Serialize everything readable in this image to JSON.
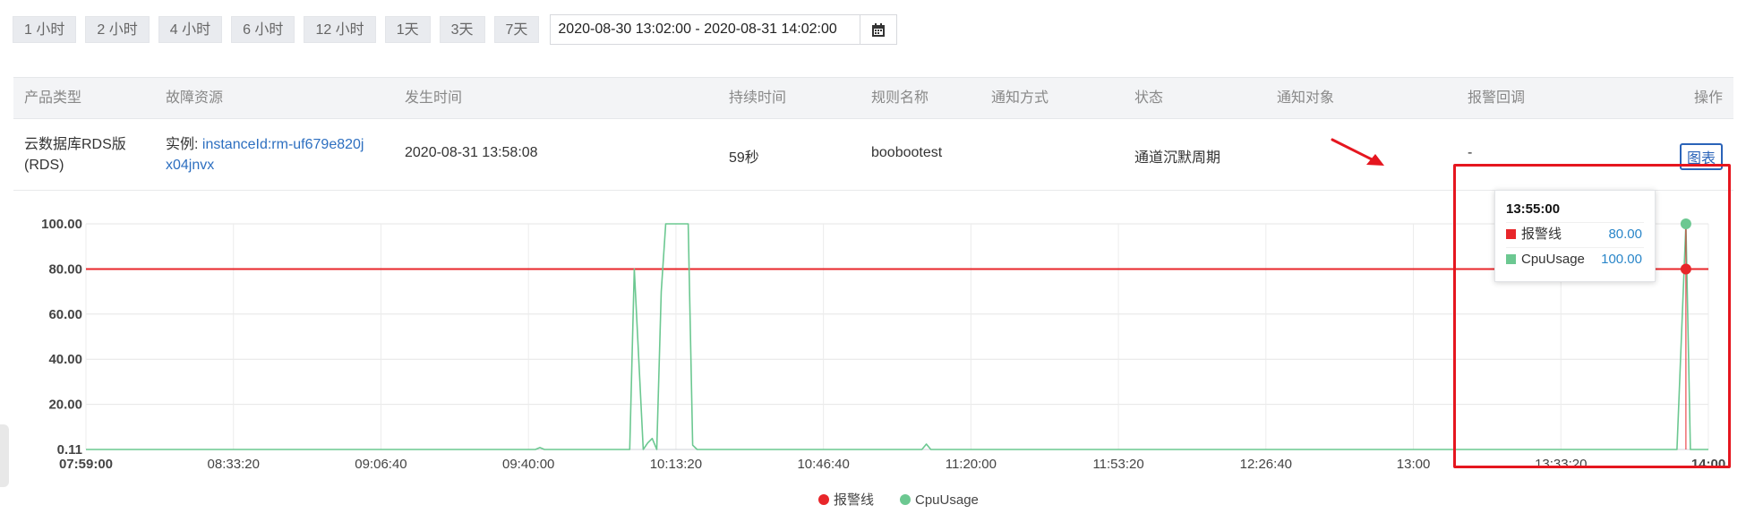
{
  "time_ranges": [
    "1 小时",
    "2 小时",
    "4 小时",
    "6 小时",
    "12 小时",
    "1天",
    "3天",
    "7天"
  ],
  "date_range": {
    "value": "2020-08-30 13:02:00 - 2020-08-31 14:02:00"
  },
  "calendar_icon": "calendar-icon",
  "table": {
    "headers": {
      "product_type": "产品类型",
      "fault_resource": "故障资源",
      "occurred_time": "发生时间",
      "duration": "持续时间",
      "rule_name": "规则名称",
      "notify_method": "通知方式",
      "status": "状态",
      "notify_target": "通知对象",
      "alarm_callback": "报警回调",
      "actions": "操作"
    },
    "row": {
      "product_type_line1": "云数据库RDS版",
      "product_type_line2": "(RDS)",
      "resource_prefix": "实例: ",
      "resource_link_line1": "instanceId:rm-uf679e820j",
      "resource_link_line2": "x04jnvx",
      "occurred_time": "2020-08-31 13:58:08",
      "duration": "59秒",
      "rule_name": "boobootest",
      "notify_method": "",
      "status": "通道沉默周期",
      "notify_target": "",
      "alarm_callback": "-",
      "action_label": "图表"
    }
  },
  "chart_data": {
    "type": "line",
    "x_tick_labels": [
      "07:59:00",
      "08:33:20",
      "09:06:40",
      "09:40:00",
      "10:13:20",
      "10:46:40",
      "11:20:00",
      "11:53:20",
      "12:26:40",
      "13:00",
      "13:33:20",
      "14:00"
    ],
    "y_tick_labels": [
      "0.11",
      "20.00",
      "40.00",
      "60.00",
      "80.00",
      "100.00"
    ],
    "ylim": [
      0.11,
      100
    ],
    "grid": true,
    "legend_position": "bottom",
    "series": [
      {
        "name": "报警线",
        "color": "#e8262a",
        "points": [
          [
            "07:59",
            80
          ],
          [
            "14:00",
            80
          ]
        ]
      },
      {
        "name": "CpuUsage",
        "color": "#6cc891",
        "points": [
          [
            "07:59",
            0.11
          ],
          [
            "09:39",
            0.11
          ],
          [
            "09:40",
            1.0
          ],
          [
            "09:41",
            0.11
          ],
          [
            "10:00",
            0.11
          ],
          [
            "10:01",
            80
          ],
          [
            "10:03",
            0.11
          ],
          [
            "10:04",
            3
          ],
          [
            "10:05",
            5
          ],
          [
            "10:06",
            0.11
          ],
          [
            "10:07",
            70
          ],
          [
            "10:08",
            100
          ],
          [
            "10:13",
            100
          ],
          [
            "10:14",
            2
          ],
          [
            "10:15",
            0.11
          ],
          [
            "11:05",
            0.11
          ],
          [
            "11:06",
            2.5
          ],
          [
            "11:07",
            0.11
          ],
          [
            "13:53",
            0.11
          ],
          [
            "13:55",
            100
          ],
          [
            "13:56",
            0.11
          ],
          [
            "14:00",
            0.11
          ]
        ]
      }
    ],
    "tooltip": {
      "time": "13:55:00",
      "items": [
        {
          "name": "报警线",
          "value": "80.00",
          "color": "#e8262a"
        },
        {
          "name": "CpuUsage",
          "value": "100.00",
          "color": "#6cc891"
        }
      ]
    }
  }
}
